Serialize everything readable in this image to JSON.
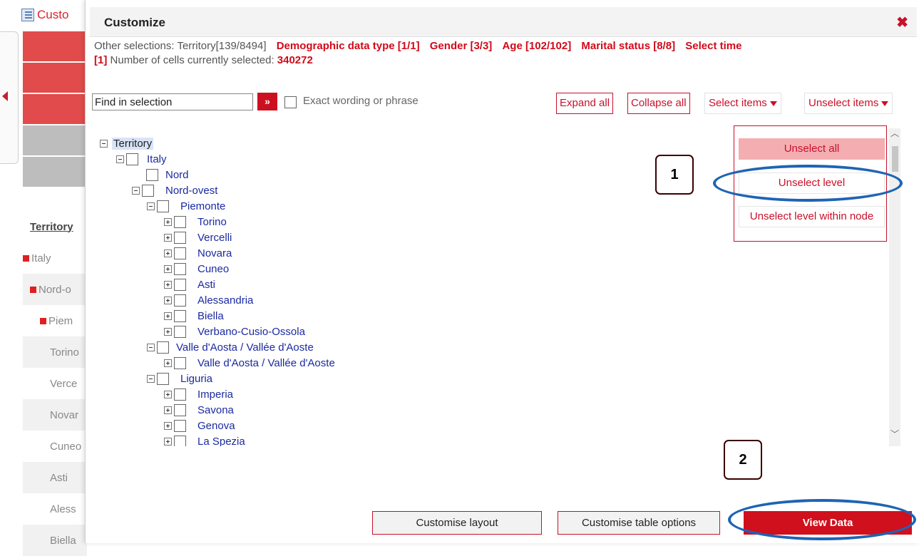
{
  "background": {
    "tab_label": "Custo",
    "list_header": "Territory",
    "rows": [
      "Italy",
      "Nord-o",
      "Piem",
      "Torino",
      "Verce",
      "Novar",
      "Cuneo",
      "Asti",
      "Aless",
      "Biella"
    ]
  },
  "dialog": {
    "title": "Customize",
    "close_icon": "close-icon",
    "summary": {
      "prefix": "Other selections: Territory[139/8494]",
      "items": [
        "Demographic data type [1/1]",
        "Gender [3/3]",
        "Age [102/102]",
        "Marital status [8/8]",
        "Select time"
      ],
      "time_count": "[1]",
      "cells_label": "Number of cells currently selected:",
      "cells_value": "340272"
    },
    "search": {
      "value": "Find in selection",
      "button_glyph": "»",
      "exact_label": "Exact wording or phrase"
    },
    "toolbar": {
      "expand_all": "Expand all",
      "collapse_all": "Collapse all",
      "select_items": "Select items",
      "unselect_items": "Unselect items"
    },
    "tree": {
      "root": "Territory",
      "nodes": [
        "Italy",
        "Nord",
        "Nord-ovest",
        "Piemonte",
        "Torino",
        "Vercelli",
        "Novara",
        "Cuneo",
        "Asti",
        "Alessandria",
        "Biella",
        "Verbano-Cusio-Ossola",
        "Valle d'Aosta / Vallée d'Aoste",
        "Valle d'Aosta / Vallée d'Aoste",
        "Liguria",
        "Imperia",
        "Savona",
        "Genova",
        "La Spezia"
      ]
    },
    "unselect_menu": {
      "items": [
        "Unselect all",
        "Unselect level",
        "Unselect level within node"
      ],
      "active_index": 0
    },
    "callouts": [
      "1",
      "2"
    ],
    "footer": {
      "customise_layout": "Customise layout",
      "customise_table_options": "Customise table options",
      "view_data": "View Data"
    }
  },
  "colors": {
    "accent": "#c9102a",
    "tree_text": "#1a2aa0",
    "annotation": "#1e64b4"
  }
}
